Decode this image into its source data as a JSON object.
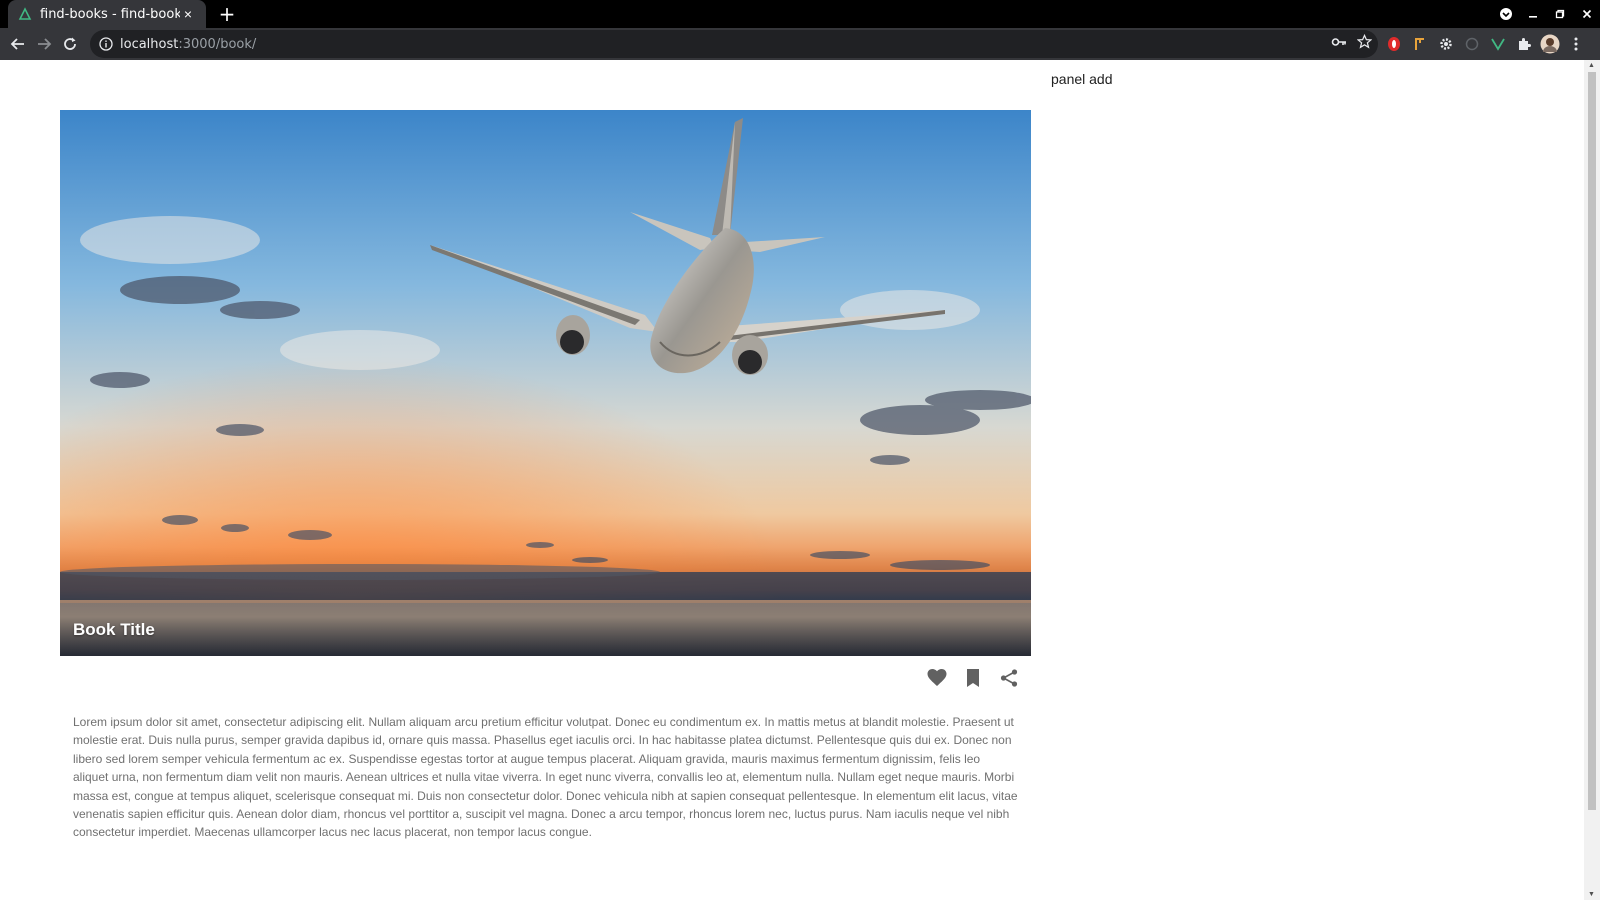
{
  "browser": {
    "tab_title": "find-books - find-books",
    "tab_close": "×",
    "new_tab": "+",
    "url_host": "localhost",
    "url_path": ":3000/book/"
  },
  "page": {
    "panel_label": "panel add",
    "card": {
      "title": "Book Title",
      "description": "Lorem ipsum dolor sit amet, consectetur adipiscing elit. Nullam aliquam arcu pretium efficitur volutpat. Donec eu condimentum ex. In mattis metus at blandit molestie. Praesent ut molestie erat. Duis nulla purus, semper gravida dapibus id, ornare quis massa. Phasellus eget iaculis orci. In hac habitasse platea dictumst. Pellentesque quis dui ex. Donec non libero sed lorem semper vehicula fermentum ac ex. Suspendisse egestas tortor at augue tempus placerat. Aliquam gravida, mauris maximus fermentum dignissim, felis leo aliquet urna, non fermentum diam velit non mauris. Aenean ultrices et nulla vitae viverra. In eget nunc viverra, convallis leo at, elementum nulla. Nullam eget neque mauris. Morbi massa est, congue at tempus aliquet, scelerisque consequat mi. Duis non consectetur dolor. Donec vehicula nibh at sapien consequat pellentesque. In elementum elit lacus, vitae venenatis sapien efficitur quis. Aenean dolor diam, rhoncus vel porttitor a, suscipit vel magna. Donec a arcu tempor, rhoncus lorem nec, luctus purus. Nam iaculis neque vel nibh consectetur imperdiet. Maecenas ullamcorper lacus nec lacus placerat, non tempor lacus congue.",
      "actions": [
        "heart-icon",
        "bookmark-icon",
        "share-icon"
      ]
    }
  },
  "colors": {
    "chrome_bg": "#000000",
    "toolbar_bg": "#35363a",
    "omnibox_bg": "#202124",
    "action_icon": "#616161",
    "body_text": "#707070"
  }
}
